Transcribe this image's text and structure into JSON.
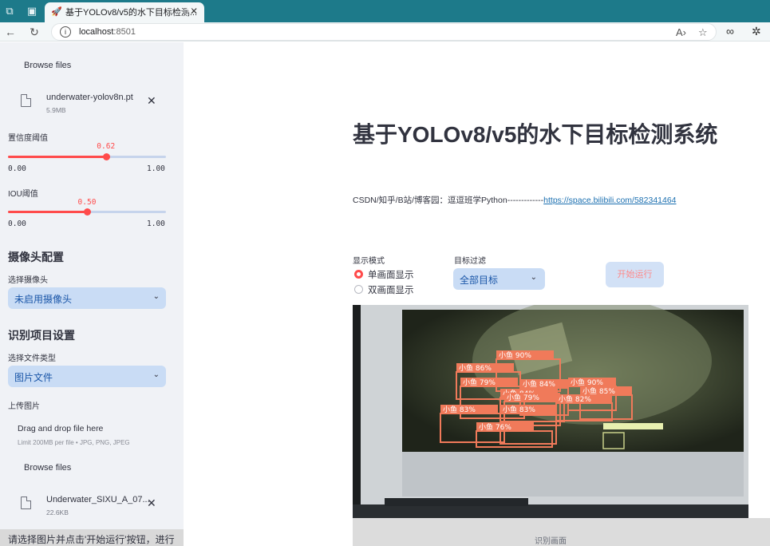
{
  "browser": {
    "tab_title": "基于YOLOv8/v5的水下目标检测...",
    "url_host": "localhost",
    "url_port": ":8501"
  },
  "sidebar": {
    "browse_label_top": "Browse files",
    "model_file": {
      "name": "underwater-yolov8n.pt",
      "size": "5.9MB"
    },
    "confidence": {
      "label": "置信度阈值",
      "value": "0.62",
      "min": "0.00",
      "max": "1.00",
      "fraction": 0.62
    },
    "iou": {
      "label": "IOU阈值",
      "value": "0.50",
      "min": "0.00",
      "max": "1.00",
      "fraction": 0.5
    },
    "camera_section": "摄像头配置",
    "camera_label": "选择摄像头",
    "camera_value": "未启用摄像头",
    "detect_section": "识别项目设置",
    "file_type_label": "选择文件类型",
    "file_type_value": "图片文件",
    "upload_label": "上传图片",
    "dropzone_title": "Drag and drop file here",
    "dropzone_sub": "Limit 200MB per file • JPG, PNG, JPEG",
    "browse_label": "Browse files",
    "image_file": {
      "name": "Underwater_SIXU_A_07...",
      "size": "22.6KB"
    },
    "status_message": "请选择图片并点击'开始运行'按钮，进行"
  },
  "main": {
    "title": "基于YOLOv8/v5的水下目标检测系统",
    "subtitle_prefix": "CSDN/知乎/B站/博客园：逗逗班学Python-------------",
    "subtitle_link": "https://space.bilibili.com/582341464",
    "display_mode_label": "显示模式",
    "mode_single": "单画面显示",
    "mode_dual": "双画面显示",
    "filter_label": "目标过滤",
    "filter_value": "全部目标",
    "start_button": "开始运行",
    "caption": "识别画面"
  },
  "detections": [
    {
      "label": "小鱼 90%"
    },
    {
      "label": "小鱼 86%"
    },
    {
      "label": "小鱼 79%"
    },
    {
      "label": "小鱼 84%"
    },
    {
      "label": "小鱼 90%"
    },
    {
      "label": "小鱼 84%"
    },
    {
      "label": "小鱼 85%"
    },
    {
      "label": "小鱼 79%"
    },
    {
      "label": "小鱼 82%"
    },
    {
      "label": "小鱼 83%"
    },
    {
      "label": "小鱼 83%"
    },
    {
      "label": "小鱼 76%"
    }
  ],
  "colors": {
    "accent": "#ff4b4b",
    "detection": "#f07a5a",
    "select_bg": "#c9dcf5",
    "sidebar_bg": "#f0f2f6"
  }
}
